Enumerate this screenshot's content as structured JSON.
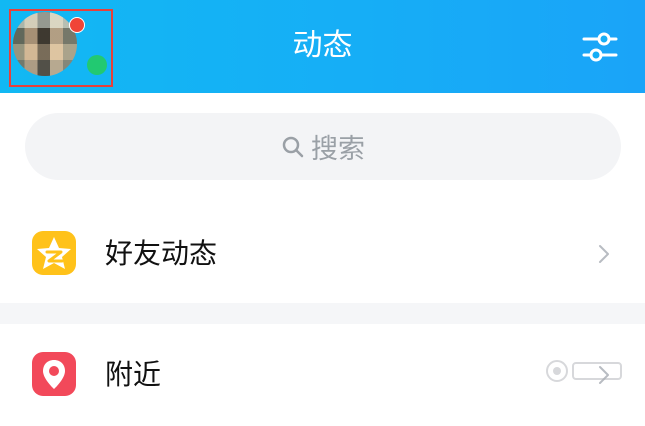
{
  "header": {
    "title": "动态",
    "avatar_icon": "user-avatar",
    "settings_icon": "sliders-icon"
  },
  "search": {
    "placeholder": "搜索",
    "icon": "search-icon"
  },
  "list": {
    "items": [
      {
        "label": "好友动态",
        "icon": "qzone-star-icon",
        "icon_color": "#ffc21a"
      },
      {
        "label": "附近",
        "icon": "location-pin-icon",
        "icon_color": "#f2495a"
      }
    ]
  },
  "colors": {
    "header_start": "#12b8f3",
    "header_end": "#1aa4f8",
    "online": "#22c971",
    "notification": "#f04438"
  }
}
